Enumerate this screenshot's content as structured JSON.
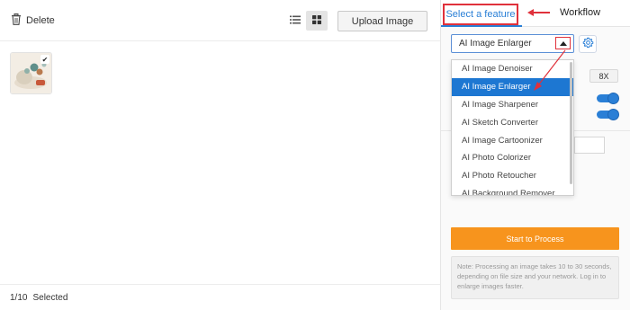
{
  "toolbar": {
    "delete_label": "Delete",
    "upload_label": "Upload Image",
    "list_view_icon": "list-view-icon",
    "grid_view_icon": "grid-view-icon",
    "active_view": "grid"
  },
  "gallery": {
    "thumbnails": [
      {
        "selected": true
      }
    ]
  },
  "status": {
    "count": "1/10",
    "selected_label": "Selected"
  },
  "tabs": {
    "select_feature": "Select a feature",
    "workflow": "Workflow"
  },
  "feature_select": {
    "value": "AI Image Enlarger"
  },
  "dropdown": {
    "options": [
      "AI Image Denoiser",
      "AI Image Enlarger",
      "AI Image Sharpener",
      "AI Sketch Converter",
      "AI Image Cartoonizer",
      "AI Photo Colorizer",
      "AI Photo Retoucher",
      "AI Background Remover"
    ],
    "selected_index": 1
  },
  "settings": {
    "scale": "8X"
  },
  "actions": {
    "start_label": "Start to Process",
    "note": "Note: Processing an image takes 10 to 30 seconds, depending on file size and your network. Log in to enlarge images faster."
  },
  "colors": {
    "accent_blue": "#2a7fd6",
    "highlight_red": "#e0313b",
    "start_orange": "#f7941d",
    "selected_row": "#1d77d2"
  }
}
